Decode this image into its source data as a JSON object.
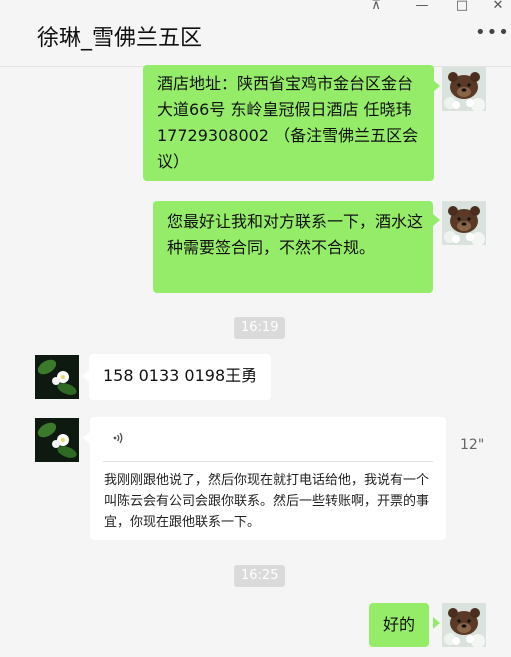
{
  "chat": {
    "title": "徐琳_雪佛兰五区",
    "more_label": "•••",
    "window_controls": {
      "pin": "⊼",
      "minimize": "—",
      "maximize": "□",
      "close": "✕"
    }
  },
  "messages": [
    {
      "from": "me",
      "text": "酒店地址：陕西省宝鸡市金台区金台大道66号 东岭皇冠假日酒店 任晓玮17729308002 （备注雪佛兰五区会议）"
    },
    {
      "from": "me",
      "text": "您最好让我和对方联系一下，酒水这种需要签合同，不然不合规。"
    },
    {
      "type": "time",
      "text": "16:19"
    },
    {
      "from": "other",
      "text": "158 0133 0198王勇"
    },
    {
      "from": "other",
      "type": "voice",
      "duration": "12\"",
      "transcript": "我刚刚跟他说了，然后你现在就打电话给他，我说有一个叫陈云会有公司会跟你联系。然后一些转账啊，开票的事宜，你现在跟他联系一下。"
    },
    {
      "type": "time",
      "text": "16:25"
    },
    {
      "from": "me",
      "text": "好的"
    }
  ],
  "icons": {
    "voice": "sound-wave-icon",
    "avatar_me": "bear-avatar",
    "avatar_other": "flower-avatar"
  },
  "colors": {
    "bubble_me": "#95ec69",
    "bubble_other": "#ffffff",
    "background": "#f5f5f5",
    "time_badge": "#dadada"
  }
}
